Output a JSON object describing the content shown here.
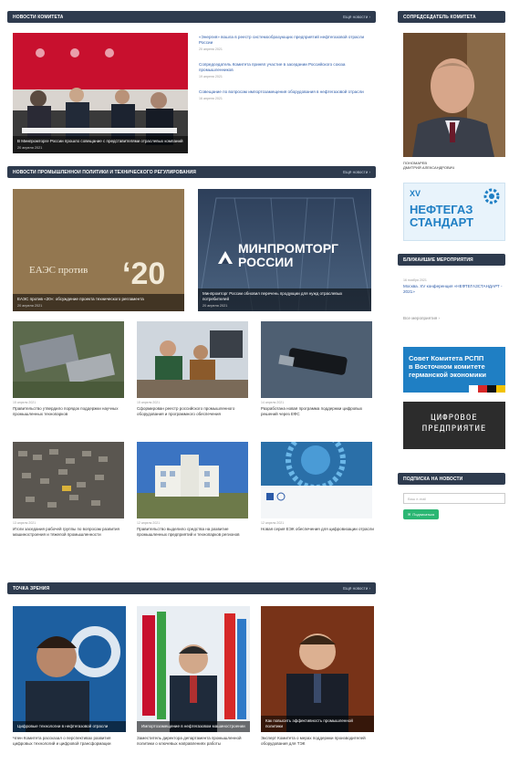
{
  "sections": {
    "news": {
      "title": "Новости Комитета",
      "more": "Ещё новости ›"
    },
    "industry": {
      "title": "Новости промышленной политики и технического регулирования",
      "more": "Ещё новости ›"
    },
    "experts": {
      "title": "Точка зрения",
      "more": "Ещё новости ›"
    },
    "chair": {
      "title": "Сопредседатель Комитета"
    },
    "events": {
      "title": "Ближайшие мероприятия"
    },
    "subscribe": {
      "title": "Подписка на новости",
      "placeholder": "Ваш e-mail",
      "button": "Подписаться"
    }
  },
  "news_main": {
    "caption": "В Минпромторге России прошло совещание с представителями отраслевых компаний",
    "date": "20 апреля 2021"
  },
  "news_links": [
    {
      "text": "«Энергия» вошла в реестр системообразующих предприятий нефтегазовой отрасли России",
      "date": "20 апреля 2021"
    },
    {
      "text": "Сопредседатель Комитета принял участие в заседании Российского союза промышленников",
      "date": "19 апреля 2021"
    },
    {
      "text": "Совещание по вопросам импортозамещения оборудования в нефтегазовой отрасли",
      "date": "16 апреля 2021"
    }
  ],
  "industry_big": [
    {
      "caption": "ЕАЭС против «20»: обсуждение проекта технического регламента",
      "date": "20 апреля 2021",
      "photo_text": "ЕАЭС против"
    },
    {
      "caption": "Минпромторг России обновил перечень продукции для нужд отраслевых потребителей",
      "date": "20 апреля 2021",
      "logo1": "МИНПРОМТОРГ",
      "logo2": "РОССИИ"
    }
  ],
  "industry_grid": [
    {
      "date": "15 апреля 2021",
      "text": "Правительство утвердило порядок поддержки научных промышленных технопарков"
    },
    {
      "date": "15 апреля 2021",
      "text": "Сформирован реестр российского промышленного оборудования и программного обеспечения"
    },
    {
      "date": "14 апреля 2021",
      "text": "Разработана новая программа поддержки цифровых решений через ЕФС"
    },
    {
      "date": "13 апреля 2021",
      "text": "Итоги заседания рабочей группы по вопросам развития машиностроения и тяжелой промышленности"
    },
    {
      "date": "12 апреля 2021",
      "text": "Правительство выделило средства на развитие промышленных предприятий и технопарков регионов"
    },
    {
      "date": "12 апреля 2021",
      "text": "Новая серия ЕЭК обеспечения для цифровизации отрасли"
    }
  ],
  "experts": [
    {
      "caption": "Цифровые технологии в нефтегазовой отрасли",
      "text": "Член Комитета рассказал о перспективах развития цифровых технологий и цифровой трансформации"
    },
    {
      "caption": "Импортозамещение в нефтегазовом машиностроении",
      "text": "Заместитель директора департамента промышленной политики о ключевых направлениях работы"
    },
    {
      "caption": "Как повысить эффективность промышленной политики",
      "text": "Эксперт Комитета о мерах поддержки производителей оборудования для ТЭК"
    }
  ],
  "chair": {
    "name_line1": "ПОНОМАРЕВ",
    "name_line2": "ДМИТРИЙ АЛЕКСАНДРОВИЧ"
  },
  "banner_neftegaz": {
    "badge": "XV",
    "title1": "НЕФТЕГАЗ",
    "title2": "СТАНДАРТ"
  },
  "event": {
    "date": "16 ноября 2021",
    "text": "Москва. XV конференция «НЕФТЕГАЗСТАНДАРТ - 2021»",
    "link": "Все мероприятия ›"
  },
  "banner_council": {
    "line1": "Совет Комитета РСПП",
    "line2": "в Восточном комитете",
    "line3": "германской экономики"
  },
  "banner_digital": {
    "line1": "ЦИФРОВОЕ",
    "line2": "ПРЕДПРИЯТИЕ"
  },
  "colors": {
    "header_bar": "#2e3b4e",
    "link": "#2b5aa8",
    "accent_green": "#2bb673",
    "banner_blue": "#1f7fc4"
  }
}
